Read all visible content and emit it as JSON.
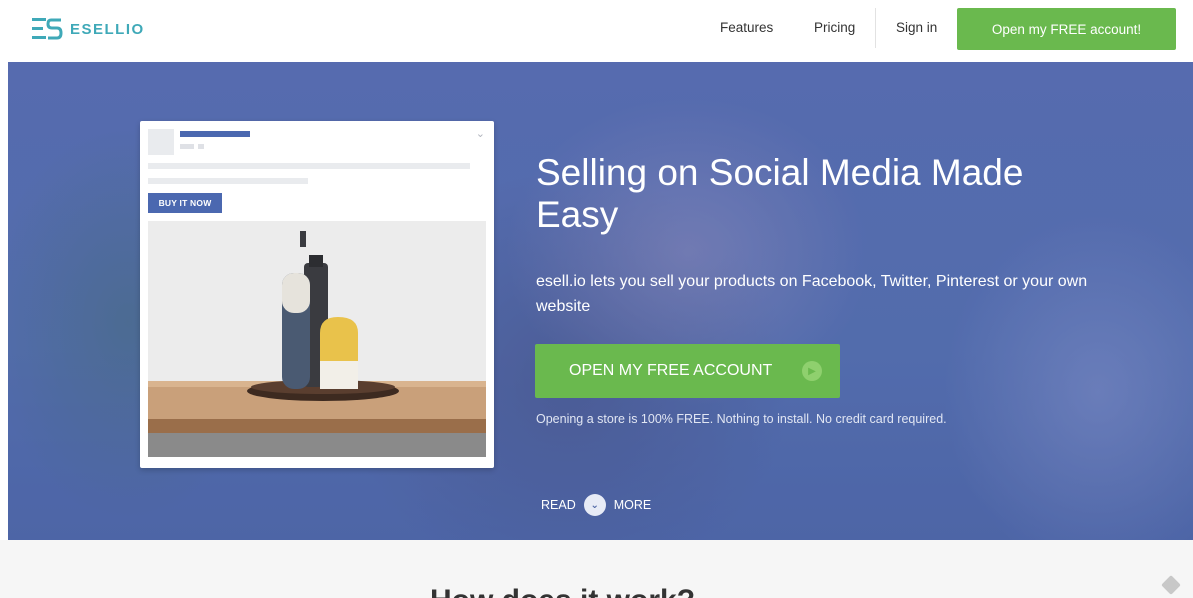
{
  "brand": {
    "name": "ESELLIO",
    "accent": "#3fa9b8"
  },
  "nav": {
    "features": "Features",
    "pricing": "Pricing",
    "signin": "Sign in",
    "cta": "Open my FREE account!"
  },
  "mock_post": {
    "button": "BUY IT NOW"
  },
  "hero": {
    "title": "Selling on Social Media Made Easy",
    "description": "esell.io lets you sell your products on Facebook, Twitter, Pinterest or your own website",
    "cta": "OPEN MY FREE ACCOUNT",
    "note": "Opening a store is 100% FREE. Nothing to install. No credit card required.",
    "read": "READ",
    "more": "MORE"
  },
  "section2": {
    "heading_partial": "How does it work?"
  },
  "colors": {
    "green": "#6ab94e",
    "hero_blue": "#5670ad",
    "fb_blue": "#4b68b0"
  }
}
